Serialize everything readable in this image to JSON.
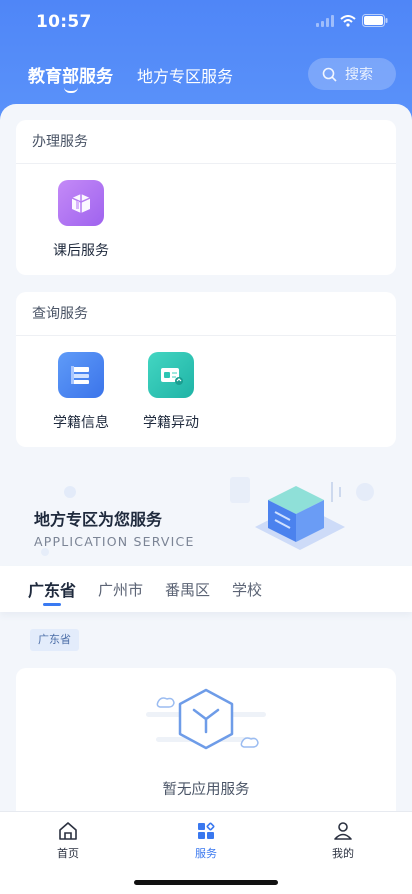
{
  "status_bar": {
    "time": "10:57"
  },
  "header": {
    "tabs": [
      {
        "label": "教育部服务",
        "active": true
      },
      {
        "label": "地方专区服务",
        "active": false
      }
    ],
    "search_placeholder": "搜索"
  },
  "handle_services": {
    "title": "办理服务",
    "items": [
      {
        "label": "课后服务",
        "icon": "book-box-icon"
      }
    ]
  },
  "query_services": {
    "title": "查询服务",
    "items": [
      {
        "label": "学籍信息",
        "icon": "document-stack-icon"
      },
      {
        "label": "学籍异动",
        "icon": "id-card-exchange-icon"
      }
    ]
  },
  "banner": {
    "title": "地方专区为您服务",
    "subtitle": "APPLICATION SERVICE"
  },
  "region": {
    "tabs": [
      {
        "label": "广东省",
        "active": true
      },
      {
        "label": "广州市",
        "active": false
      },
      {
        "label": "番禺区",
        "active": false
      },
      {
        "label": "学校",
        "active": false
      }
    ],
    "chip": "广东省",
    "empty_text": "暂无应用服务"
  },
  "tabbar": {
    "items": [
      {
        "label": "首页",
        "icon": "home-icon",
        "active": false
      },
      {
        "label": "服务",
        "icon": "grid-icon",
        "active": true
      },
      {
        "label": "我的",
        "icon": "user-icon",
        "active": false
      }
    ]
  },
  "colors": {
    "brand": "#4f86f7",
    "active_tab": "#3a78ef",
    "purple_icon": "#b57bf2",
    "blue_icon": "#4d8cf5",
    "teal_icon": "#2ec6b4"
  }
}
